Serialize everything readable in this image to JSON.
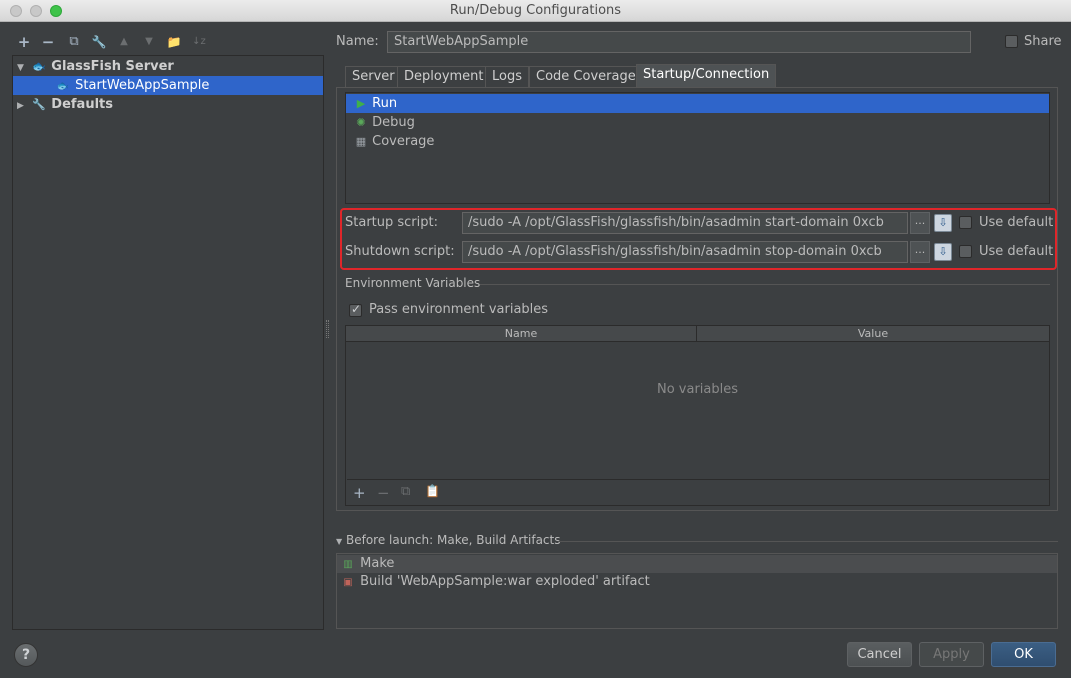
{
  "window": {
    "title": "Run/Debug Configurations"
  },
  "toolbar": {
    "add": "+",
    "remove": "−",
    "copy": "⧉",
    "edit_defaults": "🔧",
    "move_up": "▲",
    "move_down": "▼",
    "folder": "📁",
    "sort": "↓z"
  },
  "tree": {
    "items": [
      {
        "label": "GlassFish Server",
        "icon": "glassfish-icon"
      },
      {
        "label": "StartWebAppSample",
        "icon": "glassfish-config-icon"
      },
      {
        "label": "Defaults",
        "icon": "wrench-icon"
      }
    ]
  },
  "name": {
    "label": "Name:",
    "value": "StartWebAppSample"
  },
  "share": {
    "label": "Share",
    "checked": false
  },
  "tabs": [
    {
      "label": "Server"
    },
    {
      "label": "Deployment"
    },
    {
      "label": "Logs"
    },
    {
      "label": "Code Coverage"
    },
    {
      "label": "Startup/Connection",
      "active": true
    }
  ],
  "modes": [
    {
      "label": "Run",
      "icon": "play-icon",
      "selected": true
    },
    {
      "label": "Debug",
      "icon": "bug-icon"
    },
    {
      "label": "Coverage",
      "icon": "coverage-icon"
    }
  ],
  "scripts": {
    "startup": {
      "label": "Startup script:",
      "value": "/sudo -A /opt/GlassFish/glassfish/bin/asadmin start-domain 0xcb",
      "browse": "...",
      "use_default_label": "Use default",
      "use_default_checked": false
    },
    "shutdown": {
      "label": "Shutdown script:",
      "value": "/sudo -A /opt/GlassFish/glassfish/bin/asadmin stop-domain 0xcb",
      "browse": "...",
      "use_default_label": "Use default",
      "use_default_checked": false
    }
  },
  "env": {
    "section_title": "Environment Variables",
    "pass_label": "Pass environment variables",
    "pass_checked": true,
    "columns": [
      "Name",
      "Value"
    ],
    "empty_text": "No variables",
    "toolbar": {
      "add": "+",
      "remove": "−",
      "copy": "⧉",
      "paste": "📋"
    }
  },
  "before_launch": {
    "title": "Before launch: Make, Build Artifacts",
    "items": [
      {
        "label": "Make",
        "icon": "make-icon"
      },
      {
        "label": "Build 'WebAppSample:war exploded' artifact",
        "icon": "artifact-icon"
      }
    ]
  },
  "buttons": {
    "help": "?",
    "cancel": "Cancel",
    "apply": "Apply",
    "ok": "OK"
  },
  "colors": {
    "background": "#3c3f41",
    "selection": "#2f65ca",
    "highlight_border": "#e0262a",
    "primary_button": "#2f4e70"
  }
}
